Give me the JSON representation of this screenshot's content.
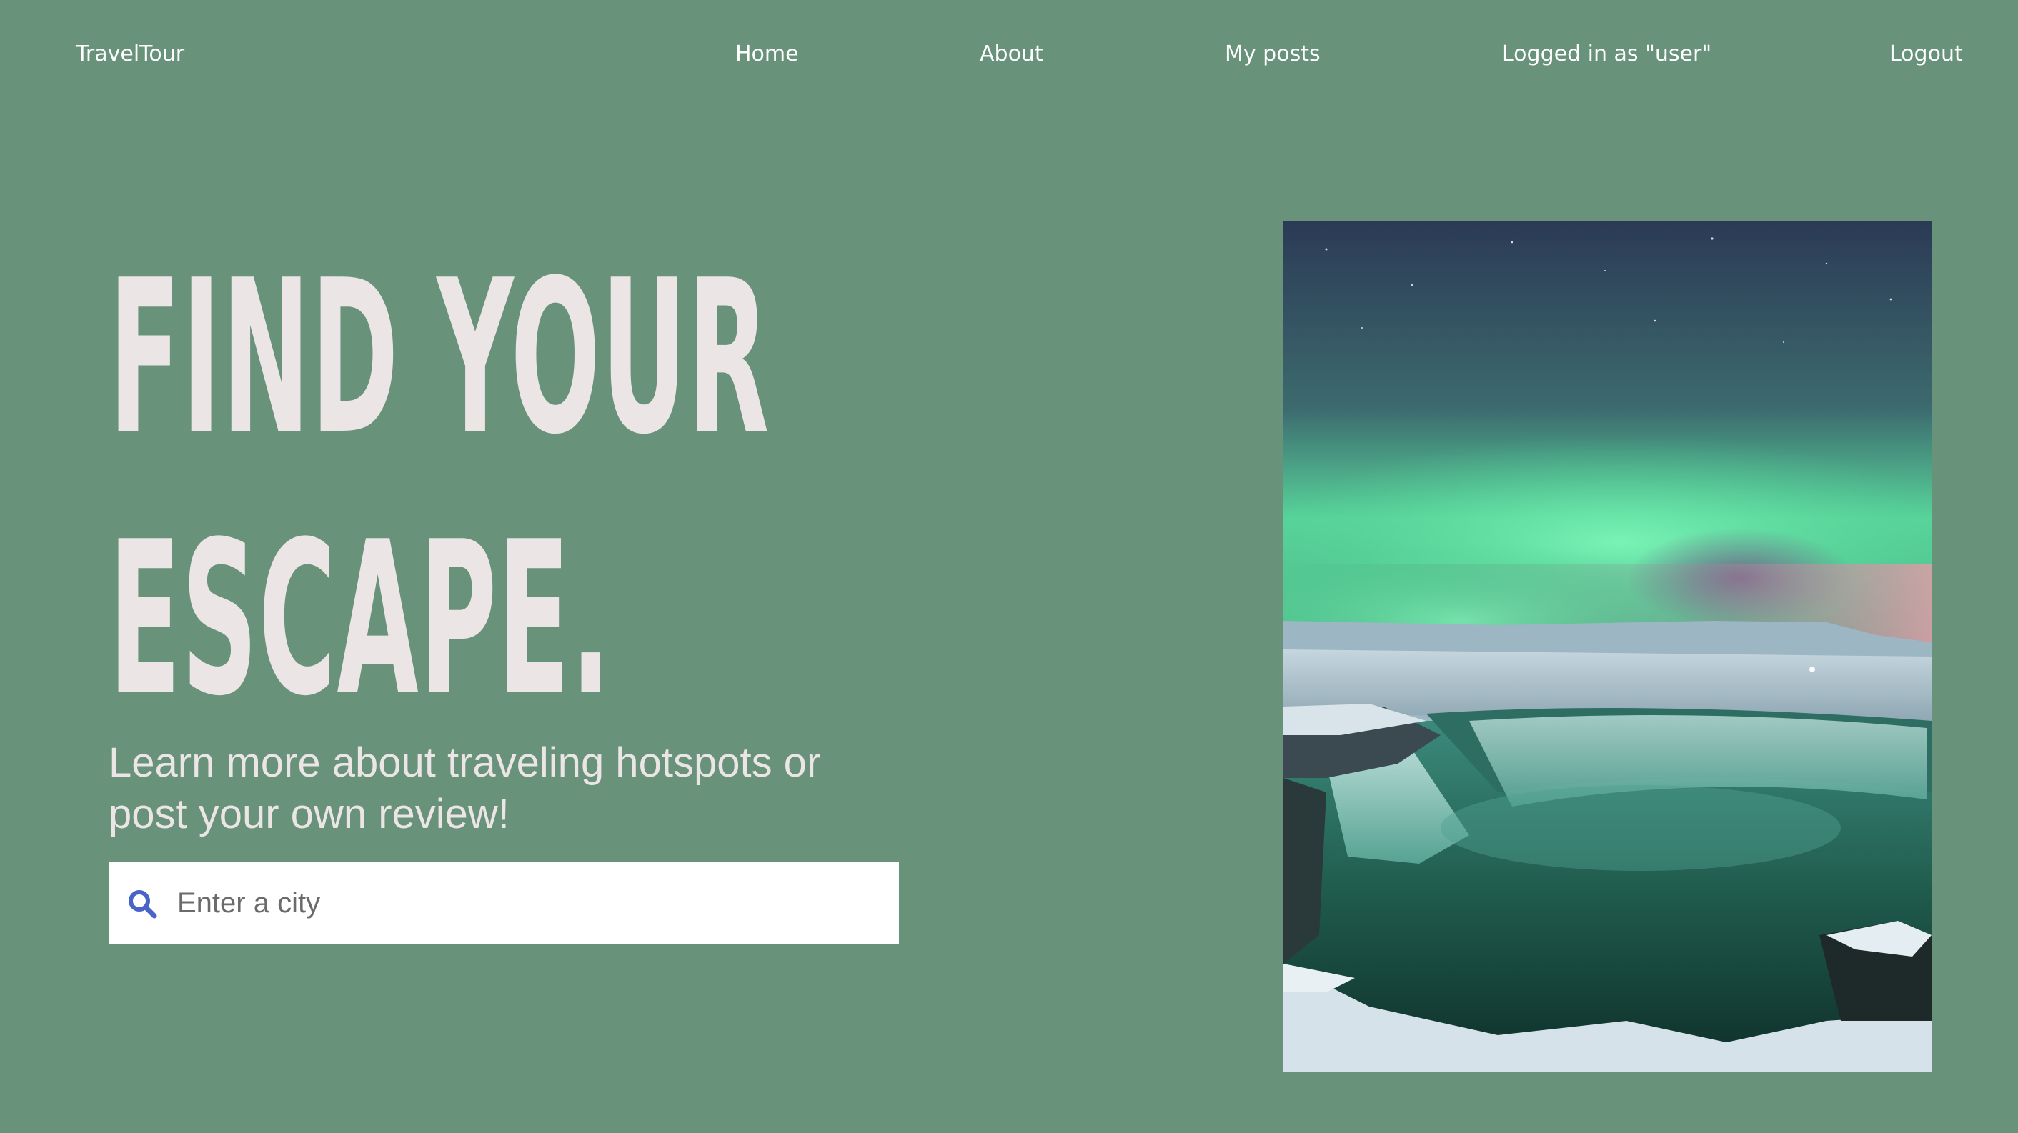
{
  "nav": {
    "brand": "TravelTour",
    "home": "Home",
    "about": "About",
    "my_posts": "My posts",
    "logged_in": "Logged in as \"user\"",
    "logout": "Logout"
  },
  "hero": {
    "title_line1": "FIND YOUR",
    "title_line2": "ESCAPE.",
    "subtitle": "Learn more about traveling hotspots or post your own review!",
    "search": {
      "placeholder": "Enter a city",
      "value": ""
    },
    "image_alt": "Aurora borealis over a frozen waterfall"
  },
  "colors": {
    "background": "#68927a",
    "title": "#ebe5e5",
    "search_icon": "#4a63c8",
    "aurora_green": "#5fe0a0"
  },
  "icons": {
    "search": "search-icon"
  }
}
